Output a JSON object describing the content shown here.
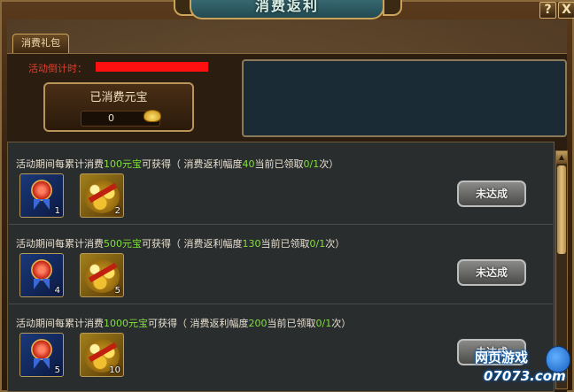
{
  "window": {
    "title": "消费返利",
    "help_label": "?",
    "close_label": "X"
  },
  "tabs": [
    {
      "label": "消费礼包"
    }
  ],
  "countdown": {
    "label": "活动倒计时："
  },
  "spent": {
    "title": "已消费元宝",
    "value": "0"
  },
  "rows": [
    {
      "prefix": "活动期间每累计消费",
      "amount": "100元宝",
      "mid": "可获得（ 消费返利幅度",
      "rate": "40",
      "claim_text": "当前已领取",
      "claim_count": "0/1",
      "suffix": "次）",
      "medal_qty": "1",
      "coins_qty": "2",
      "button": "未达成"
    },
    {
      "prefix": "活动期间每累计消费",
      "amount": "500元宝",
      "mid": "可获得（ 消费返利幅度",
      "rate": "130",
      "claim_text": "当前已领取",
      "claim_count": "0/1",
      "suffix": "次）",
      "medal_qty": "4",
      "coins_qty": "5",
      "button": "未达成"
    },
    {
      "prefix": "活动期间每累计消费",
      "amount": "1000元宝",
      "mid": "可获得（ 消费返利幅度",
      "rate": "200",
      "claim_text": "当前已领取",
      "claim_count": "0/1",
      "suffix": "次）",
      "medal_qty": "5",
      "coins_qty": "10",
      "button": "未达成"
    }
  ],
  "watermark": {
    "line1": "网页游戏",
    "line2": "07073.com"
  },
  "colors": {
    "highlight": "#7fe03a",
    "countdown": "#e04030",
    "redacted": "#ff1010"
  },
  "icons": {
    "medal": "medal-icon",
    "coins": "gold-coins-icon",
    "ingot": "gold-ingot-icon",
    "scroll_up": "chevron-up-icon"
  }
}
